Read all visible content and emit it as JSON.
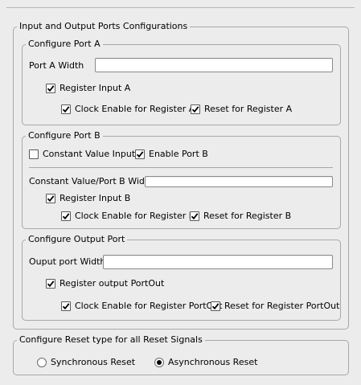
{
  "main_group": {
    "legend": "Input and Output Ports Configurations",
    "port_a": {
      "legend": "Configure Port A",
      "width_label": "Port A Width",
      "width_value": "",
      "register_input_label": "Register Input A",
      "register_input_checked": true,
      "clock_enable_label": "Clock Enable for Register A",
      "clock_enable_checked": true,
      "reset_label": "Reset for Register A",
      "reset_checked": true
    },
    "port_b": {
      "legend": "Configure Port B",
      "constant_value_input_label": "Constant Value Input",
      "constant_value_input_checked": false,
      "enable_port_label": "Enable Port B",
      "enable_port_checked": true,
      "width_label": "Constant Value/Port B Width",
      "width_value": "",
      "register_input_label": "Register Input B",
      "register_input_checked": true,
      "clock_enable_label": "Clock Enable for Register B",
      "clock_enable_checked": true,
      "reset_label": "Reset for Register B",
      "reset_checked": true
    },
    "output_port": {
      "legend": "Configure Output Port",
      "width_label": "Ouput port Width",
      "width_value": "",
      "register_output_label": "Register output PortOut",
      "register_output_checked": true,
      "clock_enable_label": "Clock Enable for Register PortOut",
      "clock_enable_checked": true,
      "reset_label": "Reset for Register PortOut",
      "reset_checked": true
    }
  },
  "reset_group": {
    "legend": "Configure Reset type for all Reset Signals",
    "options": [
      {
        "label": "Synchronous Reset",
        "selected": false
      },
      {
        "label": "Asynchronous Reset",
        "selected": true
      }
    ]
  },
  "colors": {
    "background": "#ececec",
    "border": "#a8a8a8",
    "field_bg": "#ffffff"
  },
  "icons": {
    "check": "check-icon",
    "radio_dot": "radio-dot-icon"
  }
}
